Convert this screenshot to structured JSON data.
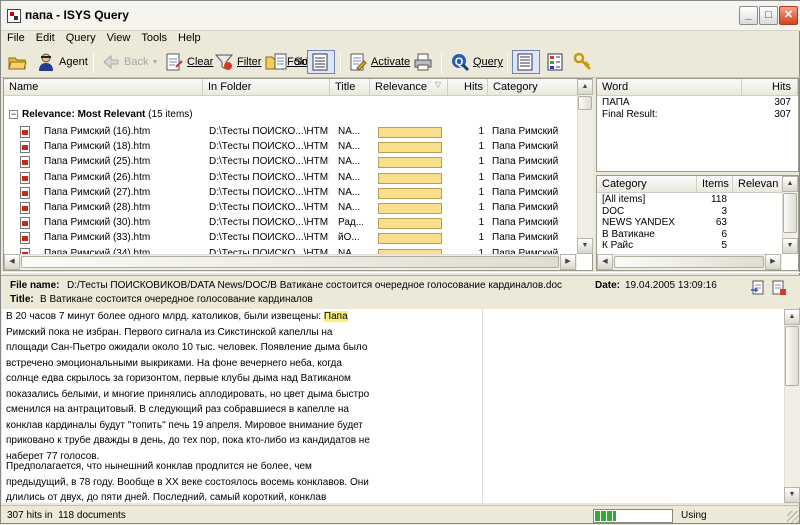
{
  "window": {
    "title": "папа - ISYS Query"
  },
  "menu": [
    "File",
    "Edit",
    "Query",
    "View",
    "Tools",
    "Help"
  ],
  "toolbar": {
    "agent": "Agent",
    "back": "Back",
    "clear": "Clear",
    "filter": "Filter",
    "folder": "Folder",
    "sort": "Sort",
    "activate": "Activate",
    "query": "Query"
  },
  "results": {
    "columns": [
      "Name",
      "In Folder",
      "Title",
      "Relevance",
      "Hits",
      "Category"
    ],
    "group_label": "Relevance: Most Relevant",
    "group_count": "(15 items)",
    "rows": [
      {
        "name": "Папа Римский (16).htm",
        "folder": "D:\\Тесты ПОИСКО...\\HTML",
        "title": "NA...",
        "relevance": 1,
        "hits": "1",
        "category": "Папа Римский"
      },
      {
        "name": "Папа Римский (18).htm",
        "folder": "D:\\Тесты ПОИСКО...\\HTML",
        "title": "NA...",
        "relevance": 1,
        "hits": "1",
        "category": "Папа Римский"
      },
      {
        "name": "Папа Римский (25).htm",
        "folder": "D:\\Тесты ПОИСКО...\\HTML",
        "title": "NA...",
        "relevance": 1,
        "hits": "1",
        "category": "Папа Римский"
      },
      {
        "name": "Папа Римский (26).htm",
        "folder": "D:\\Тесты ПОИСКО...\\HTML",
        "title": "NA...",
        "relevance": 1,
        "hits": "1",
        "category": "Папа Римский"
      },
      {
        "name": "Папа Римский (27).htm",
        "folder": "D:\\Тесты ПОИСКО...\\HTML",
        "title": "NA...",
        "relevance": 1,
        "hits": "1",
        "category": "Папа Римский"
      },
      {
        "name": "Папа Римский (28).htm",
        "folder": "D:\\Тесты ПОИСКО...\\HTML",
        "title": "NA...",
        "relevance": 1,
        "hits": "1",
        "category": "Папа Римский"
      },
      {
        "name": "Папа Римский (30).htm",
        "folder": "D:\\Тесты ПОИСКО...\\HTML",
        "title": "Рад...",
        "relevance": 1,
        "hits": "1",
        "category": "Папа Римский"
      },
      {
        "name": "Папа Римский (33).htm",
        "folder": "D:\\Тесты ПОИСКО...\\HTML",
        "title": "йО...",
        "relevance": 1,
        "hits": "1",
        "category": "Папа Римский"
      },
      {
        "name": "Папа Римский (34).htm",
        "folder": "D:\\Тесты ПОИСКО...\\HTML",
        "title": "NA...",
        "relevance": 1,
        "hits": "1",
        "category": "Папа Римский"
      }
    ]
  },
  "words": {
    "columns": [
      "Word",
      "Hits"
    ],
    "rows": [
      {
        "word": "ПАПА",
        "hits": "307"
      },
      {
        "word": "Final Result:",
        "hits": "307"
      }
    ]
  },
  "categories": {
    "columns": [
      "Category",
      "Items",
      "Relevan"
    ],
    "rows": [
      {
        "name": "[All items]",
        "items": "118"
      },
      {
        "name": "DOC",
        "items": "3"
      },
      {
        "name": "NEWS YANDEX",
        "items": "63"
      },
      {
        "name": "В Ватикане",
        "items": "6"
      },
      {
        "name": "К Райс",
        "items": "5"
      },
      {
        "name": "К...",
        "items": "2"
      }
    ]
  },
  "docinfo": {
    "file_label": "File name:",
    "file_value": "D:/Тесты ПОИСКОВИКОВ/DATA News/DOC/В Ватикане состоится очередное голосование кардиналов.doc",
    "date_label": "Date:",
    "date_value": "19.04.2005 13:09:16",
    "title_label": "Title:",
    "title_value": "В Ватикане состоится очередное голосование кардиналов"
  },
  "preview": {
    "hit_word": "Папа",
    "p1_before": "В 20 часов 7 минут более одного млрд. католиков, были извещены: ",
    "p1_after": " Римский пока не избран. Первого сигнала из Сикстинской капеллы на площади Сан-Пьетро ожидали около 10 тыс. человек. Появление дыма было встречено эмоциональными выкриками. На фоне вечернего неба, когда солнце едва скрылось за горизонтом, первые клубы дыма над Ватиканом показались белыми, и многие принялись аплодировать, но цвет дыма быстро сменился на антрацитовый. В следующий раз собравшиеся в капелле на конклав кардиналы будут \"топить\" печь 19 апреля. Мировое внимание будет приковано к трубе дважды в день, до тех пор, пока кто-либо из кандидатов не наберет 77 голосов.",
    "p2": "Предполагается, что нынешний конклав продлится не более, чем предыдущий, в 78 году. Вообще в XX веке состоялось восемь конклавов. Они длились от двух, до пяти дней. Последний, самый короткий, конклав состоялся при избрании"
  },
  "status": {
    "hits": "307 hits in",
    "docs": "118 documents",
    "state": "Using",
    "progress": 0.27
  }
}
